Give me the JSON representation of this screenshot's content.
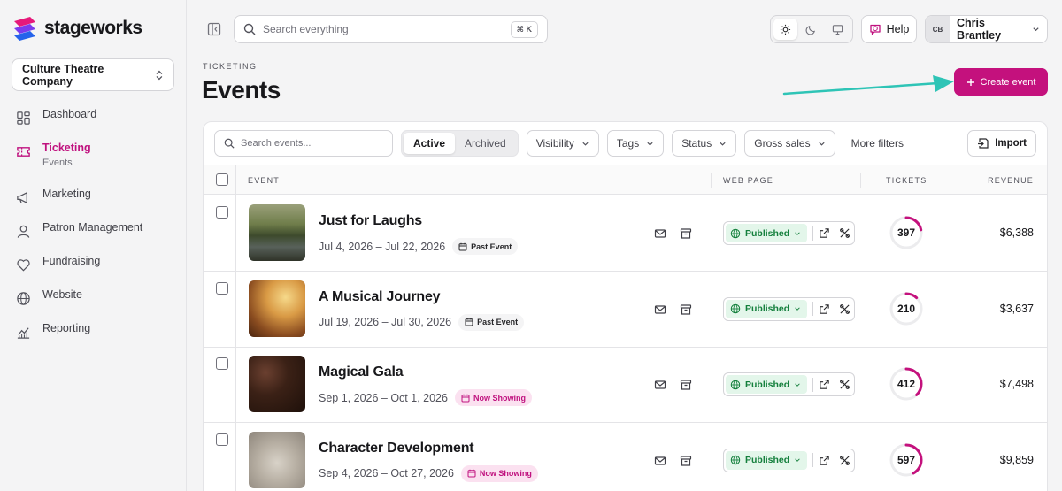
{
  "app": {
    "brand": "stageworks",
    "org": "Culture Theatre Company"
  },
  "colors": {
    "accent": "#c4117d",
    "published_bg": "#e3f6ea",
    "published_text": "#15803d"
  },
  "sidebar": {
    "items": [
      {
        "label": "Dashboard",
        "icon": "dashboard-icon"
      },
      {
        "label": "Ticketing",
        "sub": "Events",
        "icon": "ticket-icon",
        "active": true
      },
      {
        "label": "Marketing",
        "icon": "megaphone-icon"
      },
      {
        "label": "Patron Management",
        "icon": "user-icon"
      },
      {
        "label": "Fundraising",
        "icon": "heart-icon"
      },
      {
        "label": "Website",
        "icon": "globe-icon"
      },
      {
        "label": "Reporting",
        "icon": "chart-icon"
      }
    ]
  },
  "topbar": {
    "search_placeholder": "Search everything",
    "shortcut": "⌘ K",
    "help": "Help",
    "user_initials": "CB",
    "user_name": "Chris Brantley"
  },
  "page": {
    "eyebrow": "TICKETING",
    "title": "Events",
    "create_label": "Create event"
  },
  "filters": {
    "search_placeholder": "Search events...",
    "active": "Active",
    "archived": "Archived",
    "visibility": "Visibility",
    "tags": "Tags",
    "status": "Status",
    "gross_sales": "Gross sales",
    "more": "More filters",
    "import": "Import"
  },
  "table": {
    "columns": {
      "event": "EVENT",
      "web_page": "WEB PAGE",
      "tickets": "TICKETS",
      "revenue": "REVENUE"
    },
    "rows": [
      {
        "name": "Just for Laughs",
        "dates": "Jul 4, 2026 – Jul 22, 2026",
        "badge": "Past Event",
        "badge_type": "past",
        "web_status": "Published",
        "tickets": "397",
        "tickets_fill": 0.22,
        "revenue": "$6,388"
      },
      {
        "name": "A Musical Journey",
        "dates": "Jul 19, 2026 – Jul 30, 2026",
        "badge": "Past Event",
        "badge_type": "past",
        "web_status": "Published",
        "tickets": "210",
        "tickets_fill": 0.12,
        "revenue": "$3,637"
      },
      {
        "name": "Magical Gala",
        "dates": "Sep 1, 2026 – Oct 1, 2026",
        "badge": "Now Showing",
        "badge_type": "now",
        "web_status": "Published",
        "tickets": "412",
        "tickets_fill": 0.38,
        "revenue": "$7,498"
      },
      {
        "name": "Character Development",
        "dates": "Sep 4, 2026 – Oct 27, 2026",
        "badge": "Now Showing",
        "badge_type": "now",
        "web_status": "Published",
        "tickets": "597",
        "tickets_fill": 0.42,
        "revenue": "$9,859"
      }
    ]
  }
}
